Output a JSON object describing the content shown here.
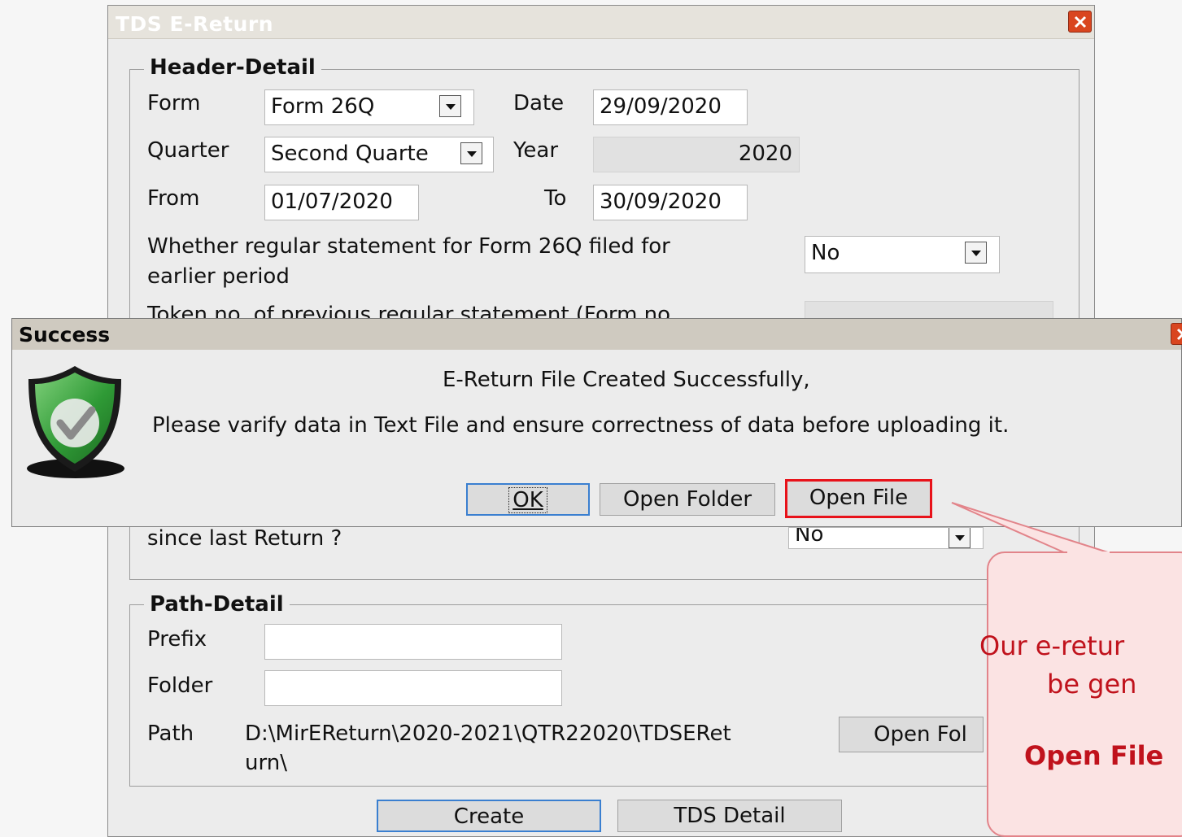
{
  "tds_window": {
    "title": "TDS E-Return",
    "header_group_title": "Header-Detail",
    "form_label": "Form",
    "form_value": "Form 26Q",
    "date_label": "Date",
    "date_value": "29/09/2020",
    "quarter_label": "Quarter",
    "quarter_value": "Second Quarte",
    "year_label": "Year",
    "year_value": "2020",
    "from_label": "From",
    "from_value": "01/07/2020",
    "to_label": "To",
    "to_value": "30/09/2020",
    "regular_statement_line1": "Whether regular statement for Form 26Q filed for",
    "regular_statement_line2": "earlier period",
    "regular_statement_value": "No",
    "token_label_partial": "Token no. of previous regular statement (Form no.",
    "change_line_partial": "since last Return ?",
    "change_value": "No",
    "path_group_title": "Path-Detail",
    "prefix_label": "Prefix",
    "prefix_value": "",
    "folder_label": "Folder",
    "folder_value": "",
    "path_label": "Path",
    "path_line1": "D:\\MirEReturn\\2020-2021\\QTR22020\\TDSERet",
    "path_line2": "urn\\",
    "open_folder_button": "Open Fol",
    "create_button": "Create",
    "tds_detail_button": "TDS Detail"
  },
  "success_dialog": {
    "title": "Success",
    "message_line1": "E-Return File Created Successfully,",
    "message_line2": "Please varify data in Text File and ensure correctness of data before uploading it.",
    "ok_button": "OK",
    "open_folder_button": "Open Folder",
    "open_file_button": "Open File"
  },
  "callout": {
    "line1": "Our e-retur",
    "line2": "be gen",
    "line3": "Open File"
  },
  "colors": {
    "highlight_red": "#e8121a",
    "callout_fill": "#fbe3e3",
    "callout_border": "#e2848a",
    "callout_text": "#c0121c",
    "focus_blue": "#3a7fd0",
    "shield_green": "#3aa63a"
  }
}
